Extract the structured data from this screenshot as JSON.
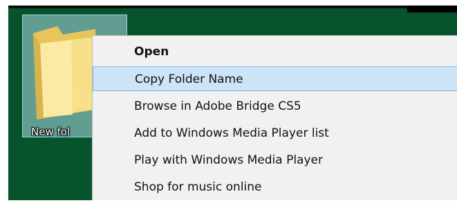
{
  "desktop": {
    "icon_label": "New fol",
    "icon": "folder-icon"
  },
  "context_menu": {
    "items": [
      {
        "label": "Open",
        "bold": true,
        "highlighted": false
      },
      {
        "label": "Copy Folder Name",
        "bold": false,
        "highlighted": true
      },
      {
        "label": "Browse in Adobe Bridge CS5",
        "bold": false,
        "highlighted": false
      },
      {
        "label": "Add to Windows Media Player list",
        "bold": false,
        "highlighted": false
      },
      {
        "label": "Play with Windows Media Player",
        "bold": false,
        "highlighted": false
      },
      {
        "label": "Shop for music online",
        "bold": false,
        "highlighted": false
      }
    ],
    "highlight_color": "#cde4f7"
  },
  "colors": {
    "desktop_background": "#06542b"
  }
}
